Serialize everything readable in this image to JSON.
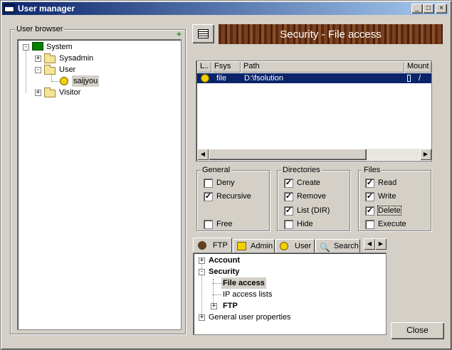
{
  "window": {
    "title": "User manager",
    "min": "_",
    "max": "□",
    "close": "×"
  },
  "user_browser": {
    "label": "User browser",
    "tree": [
      {
        "label": "System"
      },
      {
        "label": "Sysadmin"
      },
      {
        "label": "User"
      },
      {
        "label": "saijyou",
        "selected": true
      },
      {
        "label": "Visitor"
      }
    ]
  },
  "banner": {
    "title": "Security - File access"
  },
  "file_list": {
    "columns": [
      "L..",
      "Fsys",
      "Path",
      "Mount"
    ],
    "rows": [
      {
        "fsys": "file",
        "path": "D:\\fsolution",
        "mount": "/"
      }
    ]
  },
  "general": {
    "label": "General",
    "deny": "Deny",
    "recursive": "Recursive",
    "free": "Free"
  },
  "directories": {
    "label": "Directories",
    "create": "Create",
    "remove": "Remove",
    "list": "List (DIR)",
    "hide": "Hide"
  },
  "files": {
    "label": "Files",
    "read": "Read",
    "write": "Write",
    "delete": "Delete",
    "execute": "Execute"
  },
  "tabs": [
    "FTP",
    "Admin",
    "User",
    "Search"
  ],
  "settings_tree": {
    "account": "Account",
    "security": "Security",
    "file_access": "File access",
    "ip_access": "IP access lists",
    "ftp": "FTP",
    "general_props": "General user properties"
  },
  "close_button": "Close"
}
